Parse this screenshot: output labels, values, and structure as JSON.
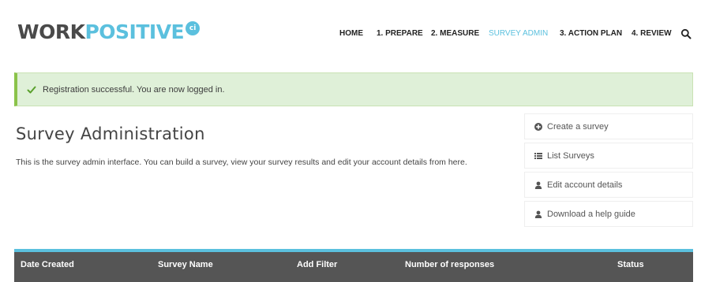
{
  "brand": {
    "part1": "WORK",
    "part2": "POSITIVE",
    "badge": "ci",
    "color_dark": "#4a4a4a",
    "color_accent": "#5bc0de"
  },
  "nav": {
    "items": [
      {
        "label": "HOME",
        "active": false
      },
      {
        "label": "1. PREPARE",
        "active": false
      },
      {
        "label": "2. MEASURE",
        "active": false
      },
      {
        "label": "SURVEY ADMIN",
        "active": true
      },
      {
        "label": "3. ACTION PLAN",
        "active": false
      },
      {
        "label": "4. REVIEW",
        "active": false
      }
    ],
    "search_icon": "search-icon"
  },
  "alert": {
    "icon": "check-icon",
    "message": "Registration successful. You are now logged in.",
    "bg_color": "#dff0d8",
    "border_color": "#8bc34a"
  },
  "main": {
    "title": "Survey Administration",
    "description": "This is the survey admin interface. You can build a survey, view your survey results and edit your account details from here."
  },
  "side_menu": {
    "items": [
      {
        "label": "Create a survey",
        "icon": "plus-circle-icon"
      },
      {
        "label": "List Surveys",
        "icon": "list-icon"
      },
      {
        "label": "Edit account details",
        "icon": "user-icon"
      },
      {
        "label": "Download a help guide",
        "icon": "user-icon"
      }
    ]
  },
  "table": {
    "columns": [
      "Date Created",
      "Survey Name",
      "Add Filter",
      "Number of responses",
      "Status"
    ],
    "header_bg": "#555555"
  }
}
